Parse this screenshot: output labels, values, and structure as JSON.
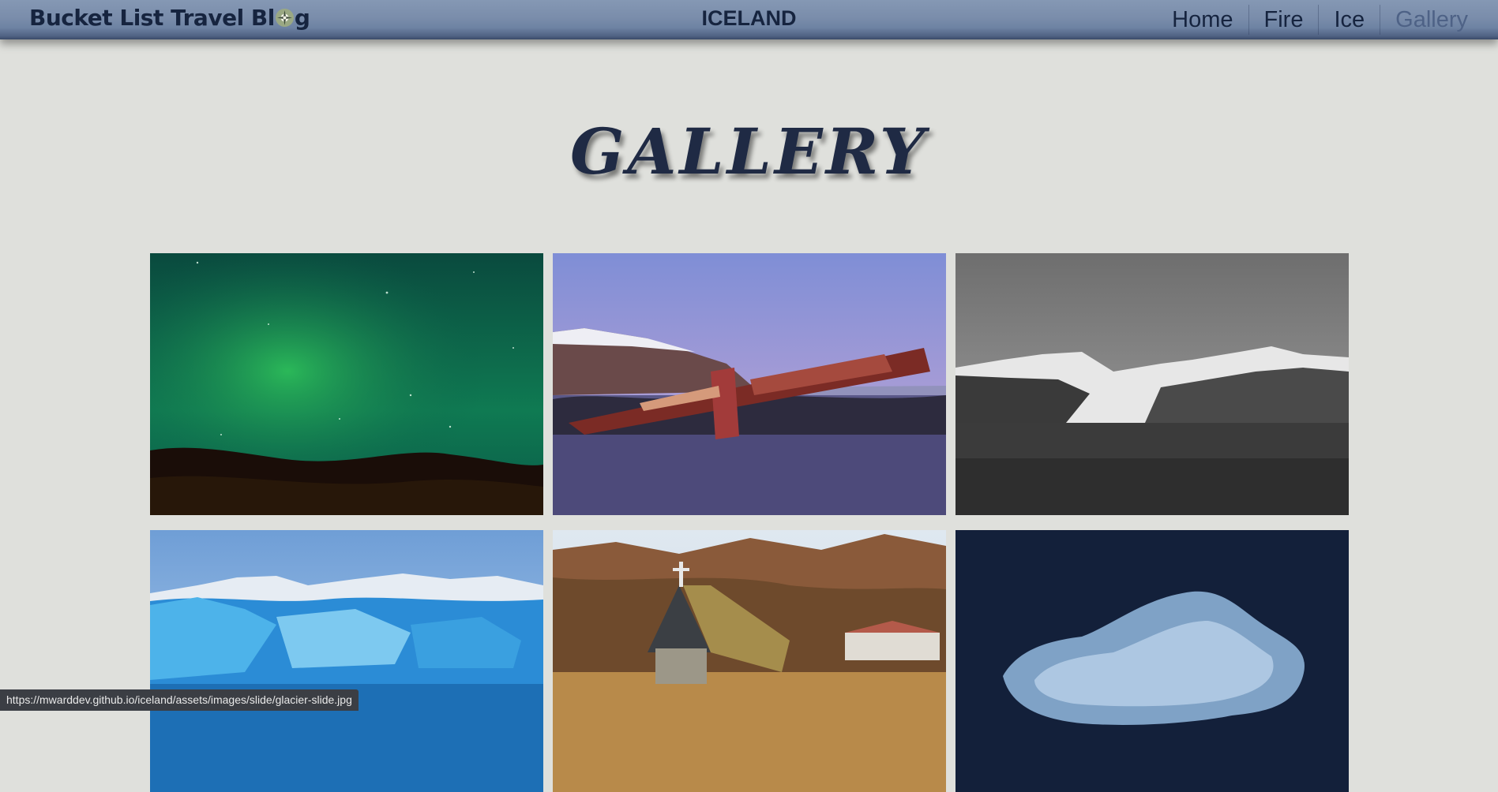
{
  "header": {
    "brand_part1": "Bucket List Travel Bl",
    "brand_part2": "g",
    "brand_icon": "compass-icon",
    "center_title": "ICELAND",
    "nav": [
      "Home",
      "Fire",
      "Ice",
      "Gallery"
    ],
    "active_nav": "Gallery"
  },
  "main": {
    "heading": "GALLERY",
    "images": [
      {
        "subject": "aurora",
        "icon": "aurora-photo"
      },
      {
        "subject": "wreck",
        "icon": "bridge-wreck-photo"
      },
      {
        "subject": "mountains",
        "icon": "mountain-photo"
      },
      {
        "subject": "glacier",
        "icon": "glacier-photo"
      },
      {
        "subject": "church",
        "icon": "turf-church-photo"
      },
      {
        "subject": "ice",
        "icon": "ice-chunk-photo"
      }
    ]
  },
  "status_bar": {
    "url": "https://mwarddev.github.io/iceland/assets/images/slide/glacier-slide.jpg"
  },
  "colors": {
    "nav_bg": "#7a8dab",
    "text_dark": "#16243f",
    "active_nav": "#4e6286",
    "page_bg": "#dfe0dc"
  }
}
